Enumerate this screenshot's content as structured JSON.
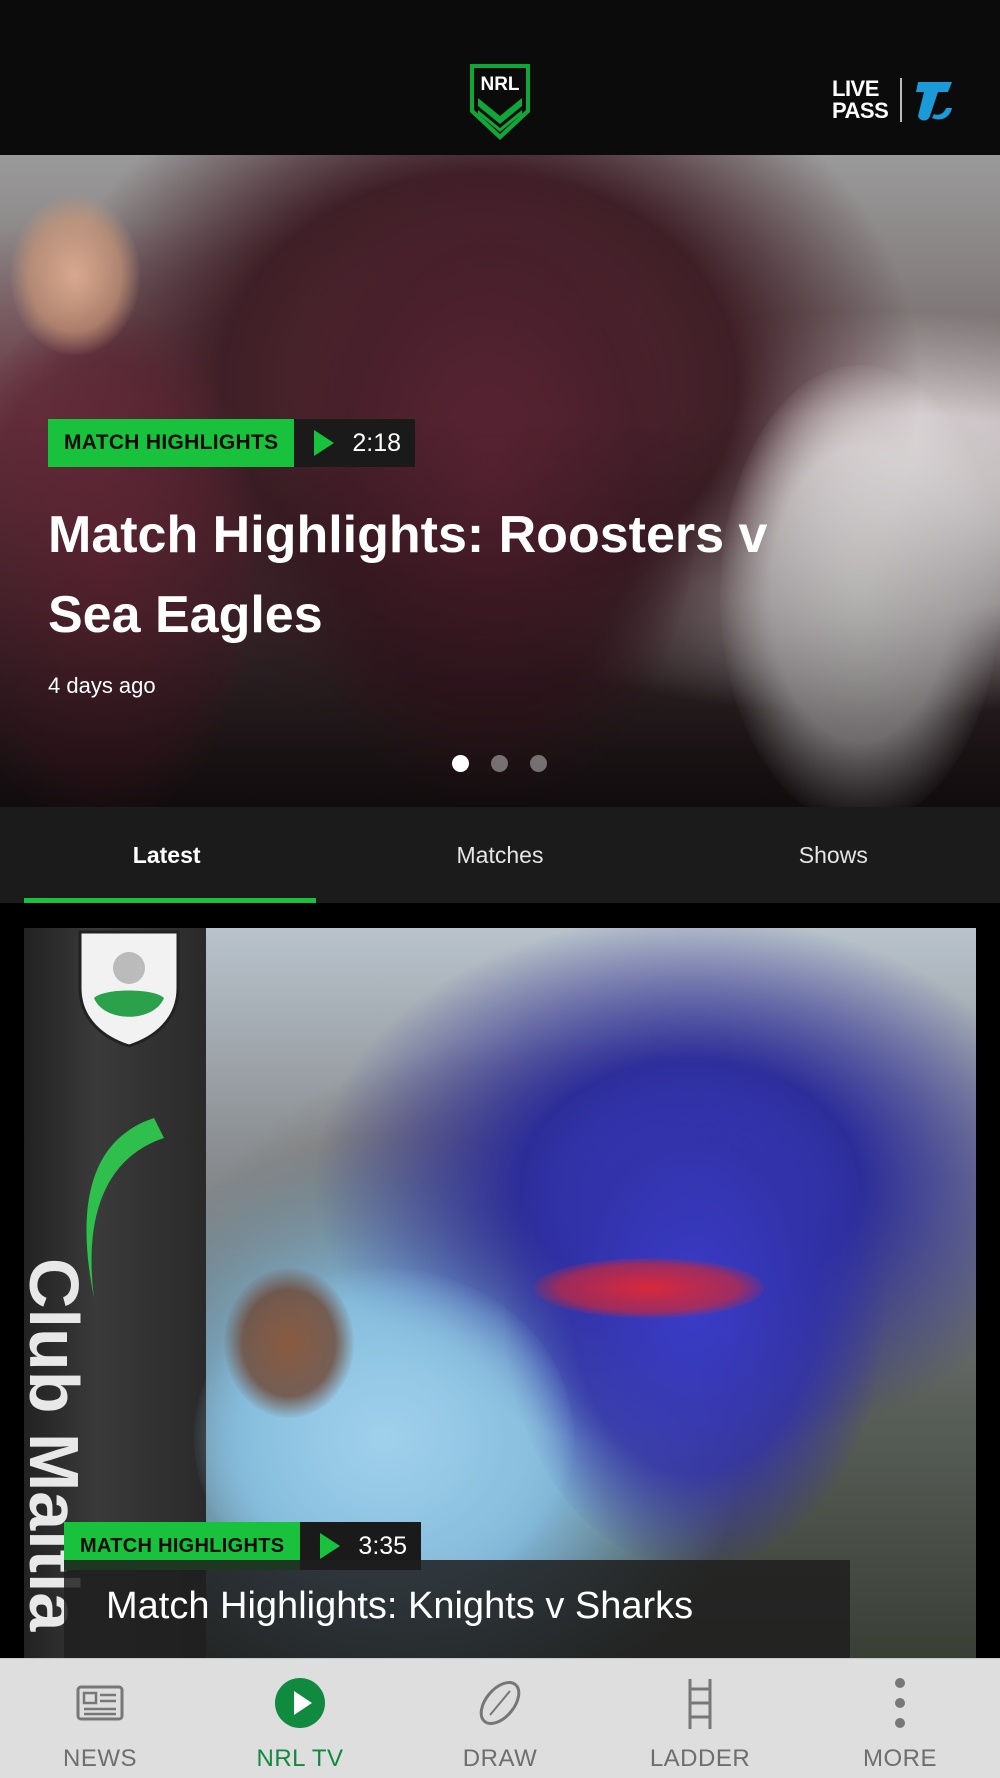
{
  "header": {
    "logo_text": "NRL",
    "livepass_line1": "LIVE",
    "livepass_line2": "PASS"
  },
  "hero": {
    "category": "MATCH HIGHLIGHTS",
    "duration": "2:18",
    "title": "Match Highlights: Roosters v Sea Eagles",
    "time_ago": "4 days ago",
    "carousel_count": 3,
    "carousel_active": 1
  },
  "tabs": [
    {
      "label": "Latest",
      "active": true
    },
    {
      "label": "Matches",
      "active": false
    },
    {
      "label": "Shows",
      "active": false
    }
  ],
  "card": {
    "category": "MATCH HIGHLIGHTS",
    "duration": "3:35",
    "title": "Match Highlights: Knights v Sharks",
    "post_text": "Club Maitla"
  },
  "bottom_nav": [
    {
      "label": "NEWS",
      "icon": "news-icon",
      "active": false
    },
    {
      "label": "NRL TV",
      "icon": "play-circle-icon",
      "active": true
    },
    {
      "label": "DRAW",
      "icon": "football-icon",
      "active": false
    },
    {
      "label": "LADDER",
      "icon": "ladder-icon",
      "active": false
    },
    {
      "label": "MORE",
      "icon": "more-icon",
      "active": false
    }
  ],
  "colors": {
    "accent": "#19c23d",
    "nav_active": "#0f8a3e",
    "header_bg": "#0b0b0b",
    "telstra_blue": "#1a9ad8"
  }
}
